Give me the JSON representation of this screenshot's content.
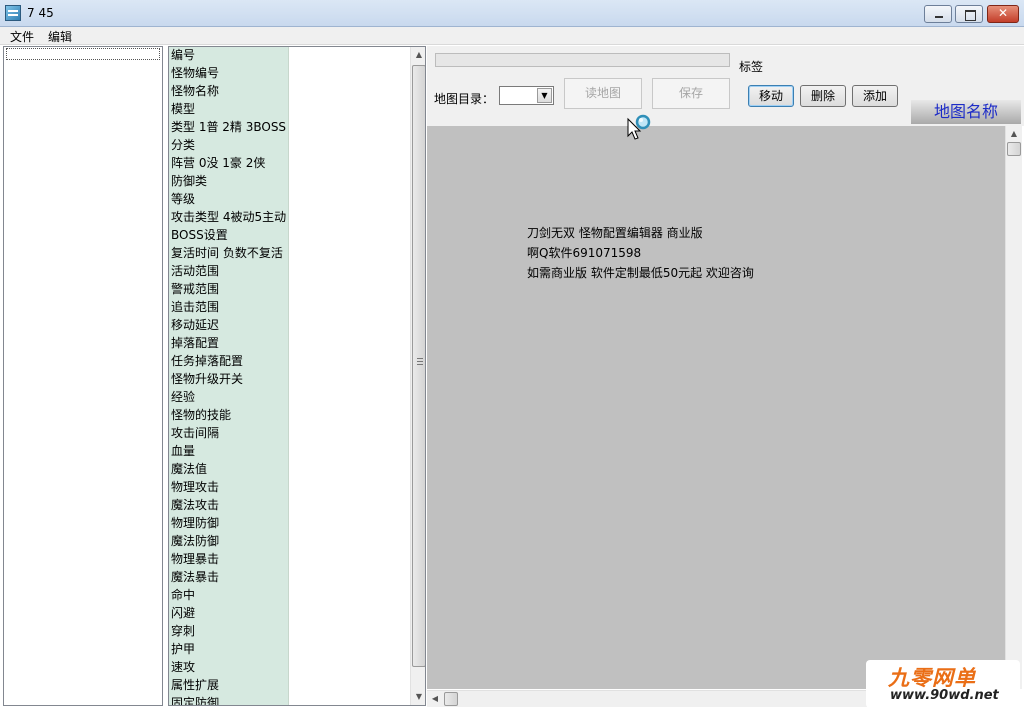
{
  "window": {
    "title": "7 45"
  },
  "menu": {
    "file": "文件",
    "edit": "编辑"
  },
  "properties": [
    "编号",
    "怪物编号",
    "怪物名称",
    "模型",
    "类型 1普 2精 3BOSS",
    "分类",
    "阵营 0没 1豪 2侠",
    "防御类",
    "等级",
    "攻击类型 4被动5主动",
    "BOSS设置",
    "复活时间 负数不复活",
    "活动范围",
    "警戒范围",
    "追击范围",
    "移动延迟",
    "掉落配置",
    "任务掉落配置",
    "怪物升级开关",
    "经验",
    "怪物的技能",
    "攻击间隔",
    "血量",
    "魔法值",
    "物理攻击",
    "魔法攻击",
    "物理防御",
    "魔法防御",
    "物理暴击",
    "魔法暴击",
    "命中",
    "闪避",
    "穿刺",
    "护甲",
    "速攻",
    "属性扩展",
    "固定防御"
  ],
  "toolbar": {
    "tag_label": "标签",
    "map_dir_label": "地图目录：",
    "read_map": "读地图",
    "save": "保存",
    "move": "移动",
    "delete": "删除",
    "add": "添加",
    "map_name": "地图名称"
  },
  "canvas_lines": [
    "刀剑无双  怪物配置编辑器  商业版",
    "啊Q软件691071598",
    "如需商业版  软件定制最低50元起  欢迎咨询"
  ],
  "watermark": {
    "brand": "九零网单",
    "url": "www.90wd.net"
  }
}
